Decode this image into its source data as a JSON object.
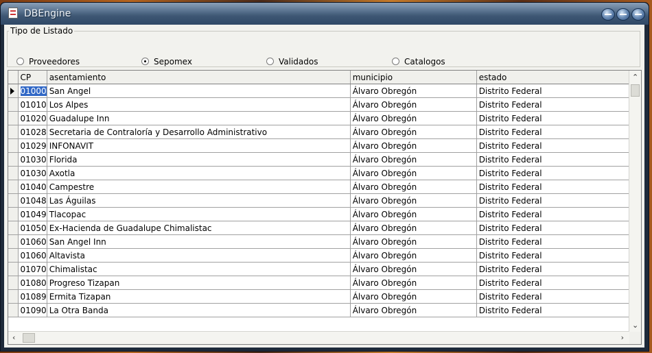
{
  "window": {
    "title": "DBEngine"
  },
  "listing": {
    "legend": "Tipo de Listado",
    "options": [
      {
        "label": "Proveedores",
        "selected": false
      },
      {
        "label": "Sepomex",
        "selected": true
      },
      {
        "label": "Validados",
        "selected": false
      },
      {
        "label": "Catalogos",
        "selected": false
      }
    ]
  },
  "grid": {
    "columns": [
      "CP",
      "asentamiento",
      "municipio",
      "estado"
    ],
    "selected_row": 0,
    "rows": [
      [
        "01000",
        "San Angel",
        "Álvaro Obregón",
        "Distrito Federal"
      ],
      [
        "01010",
        "Los Alpes",
        "Álvaro Obregón",
        "Distrito Federal"
      ],
      [
        "01020",
        "Guadalupe Inn",
        "Álvaro Obregón",
        "Distrito Federal"
      ],
      [
        "01028",
        "Secretaria de Contraloría y Desarrollo Administrativo",
        "Álvaro Obregón",
        "Distrito Federal"
      ],
      [
        "01029",
        "INFONAVIT",
        "Álvaro Obregón",
        "Distrito Federal"
      ],
      [
        "01030",
        "Florida",
        "Álvaro Obregón",
        "Distrito Federal"
      ],
      [
        "01030",
        "Axotla",
        "Álvaro Obregón",
        "Distrito Federal"
      ],
      [
        "01040",
        "Campestre",
        "Álvaro Obregón",
        "Distrito Federal"
      ],
      [
        "01048",
        "Las Águilas",
        "Álvaro Obregón",
        "Distrito Federal"
      ],
      [
        "01049",
        "Tlacopac",
        "Álvaro Obregón",
        "Distrito Federal"
      ],
      [
        "01050",
        "Ex-Hacienda de Guadalupe Chimalistac",
        "Álvaro Obregón",
        "Distrito Federal"
      ],
      [
        "01060",
        "San Angel Inn",
        "Álvaro Obregón",
        "Distrito Federal"
      ],
      [
        "01060",
        "Altavista",
        "Álvaro Obregón",
        "Distrito Federal"
      ],
      [
        "01070",
        "Chimalistac",
        "Álvaro Obregón",
        "Distrito Federal"
      ],
      [
        "01080",
        "Progreso Tizapan",
        "Álvaro Obregón",
        "Distrito Federal"
      ],
      [
        "01089",
        "Ermita Tizapan",
        "Álvaro Obregón",
        "Distrito Federal"
      ],
      [
        "01090",
        "La Otra Banda",
        "Álvaro Obregón",
        "Distrito Federal"
      ]
    ]
  }
}
